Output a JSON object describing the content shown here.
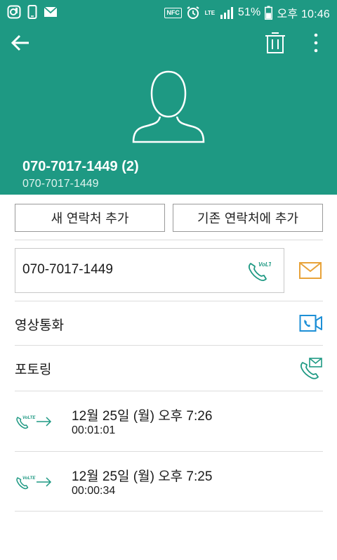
{
  "status_bar": {
    "battery": "51%",
    "time": "오후 10:46",
    "nfc": "NFC",
    "lte": "LTE"
  },
  "contact": {
    "title": "070-7017-1449 (2)",
    "subtitle": "070-7017-1449"
  },
  "actions": {
    "add_new_contact": "새 연락처 추가",
    "add_to_existing": "기존 연락처에 추가"
  },
  "phone": {
    "number": "070-7017-1449",
    "volte_badge": "VoLTE"
  },
  "rows": {
    "video_call": "영상통화",
    "totring": "포토링"
  },
  "call_log": [
    {
      "date": "12월 25일 (월) 오후 7:26",
      "duration": "00:01:01",
      "badge": "VoLTE"
    },
    {
      "date": "12월 25일 (월) 오후 7:25",
      "duration": "00:00:34",
      "badge": "VoLTE"
    }
  ],
  "colors": {
    "header": "#1e9983",
    "accent_teal": "#1e9983",
    "mail_orange": "#e8a33a",
    "video_blue": "#1d8fd6"
  },
  "icons": [
    "back-arrow-icon",
    "trash-icon",
    "more-vert-icon",
    "person-placeholder-icon",
    "volte-call-icon",
    "mail-icon",
    "video-call-icon",
    "totring-icon",
    "outgoing-call-icon"
  ]
}
